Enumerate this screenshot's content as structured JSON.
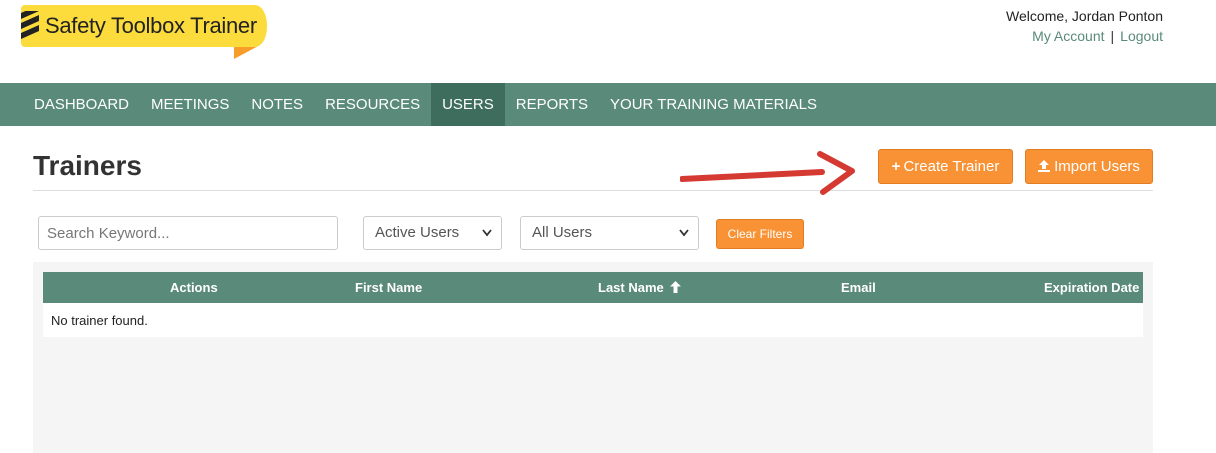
{
  "brand": {
    "name": "Safety Toolbox Trainer"
  },
  "header": {
    "welcome": "Welcome, Jordan Ponton",
    "my_account": "My Account",
    "separator": "|",
    "logout": "Logout"
  },
  "nav": {
    "items": [
      {
        "label": "DASHBOARD",
        "active": false
      },
      {
        "label": "MEETINGS",
        "active": false
      },
      {
        "label": "NOTES",
        "active": false
      },
      {
        "label": "RESOURCES",
        "active": false
      },
      {
        "label": "USERS",
        "active": true
      },
      {
        "label": "REPORTS",
        "active": false
      },
      {
        "label": "YOUR TRAINING MATERIALS",
        "active": false
      }
    ]
  },
  "page": {
    "title": "Trainers",
    "create_button": "Create Trainer",
    "import_button": "Import Users"
  },
  "filters": {
    "search_placeholder": "Search Keyword...",
    "status_select": "Active Users",
    "type_select": "All Users",
    "clear_button": "Clear Filters"
  },
  "table": {
    "columns": [
      "Actions",
      "First Name",
      "Last Name",
      "Email",
      "Expiration Date"
    ],
    "sorted_column": "Last Name",
    "empty_message": "No trainer found."
  },
  "colors": {
    "nav_bg": "#5a8a7a",
    "nav_active": "#3e6d5d",
    "accent_orange": "#f89235",
    "logo_yellow": "#fbdc3c",
    "annotation_arrow": "#d43a32"
  },
  "icons": {
    "logo": "caution-stripes-icon",
    "create": "plus-icon",
    "import": "upload-icon",
    "sort": "arrow-up-icon",
    "select": "chevron-down-icon"
  }
}
